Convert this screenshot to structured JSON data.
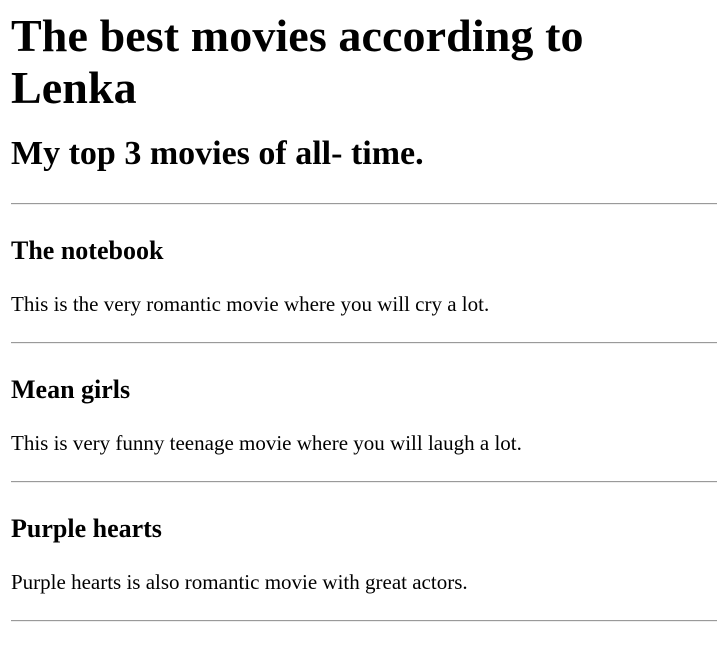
{
  "page": {
    "title": "The best movies according to Lenka",
    "subtitle": "My top 3 movies of all- time."
  },
  "movies": [
    {
      "title": "The notebook",
      "description": "This is the very romantic movie where you will cry a lot."
    },
    {
      "title": "Mean girls",
      "description": "This is very funny teenage movie where you will laugh a lot."
    },
    {
      "title": "Purple hearts",
      "description": "Purple hearts is also romantic movie with great actors."
    }
  ]
}
